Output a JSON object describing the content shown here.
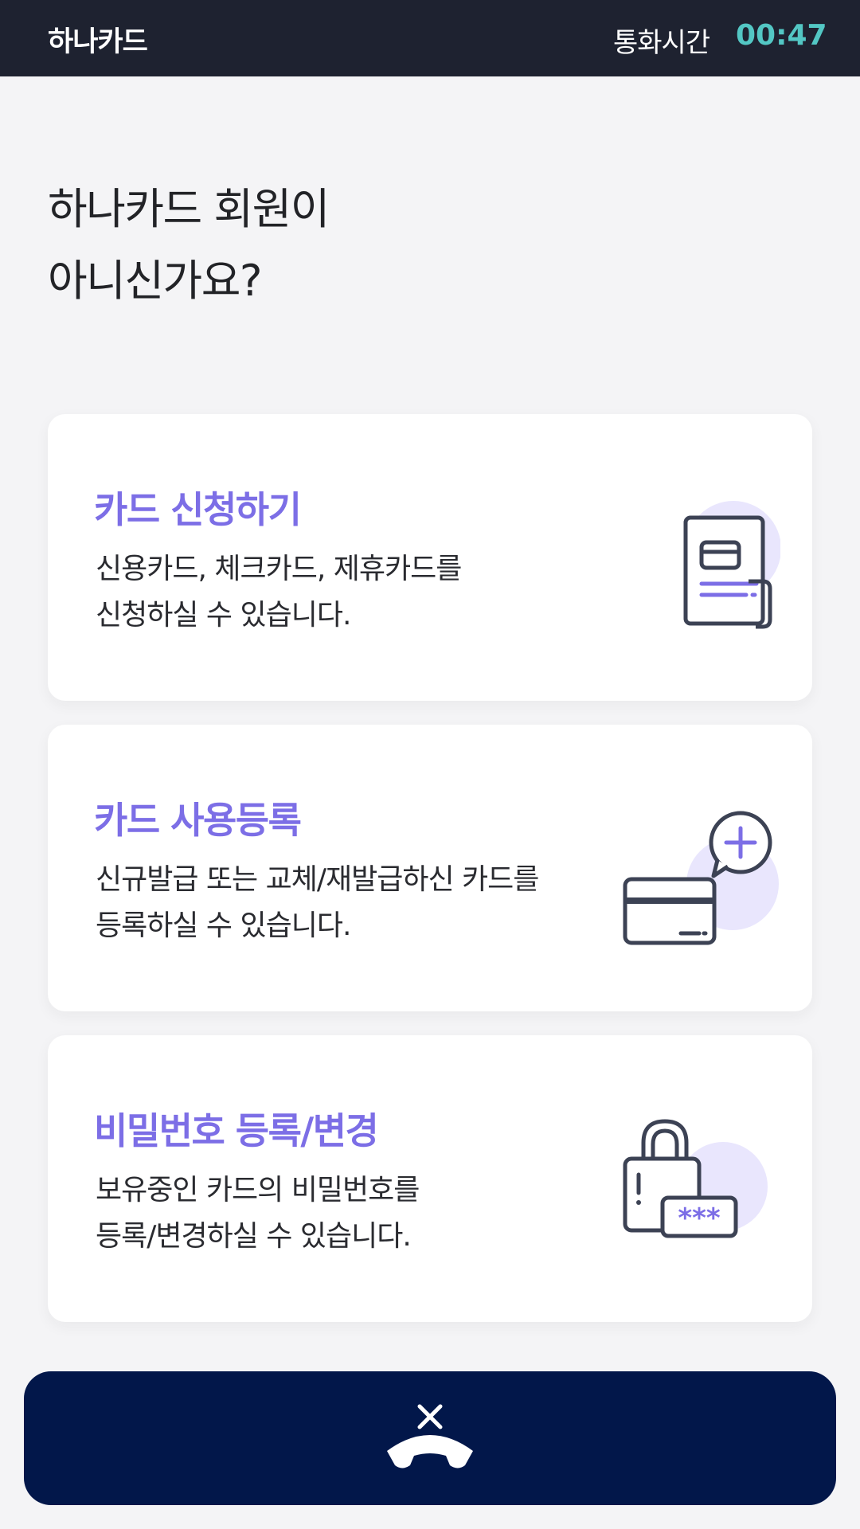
{
  "header": {
    "brand": "하나카드",
    "call_label": "통화시간",
    "call_time": "00:47"
  },
  "title": {
    "line1": "하나카드 회원이",
    "line2": "아니신가요?"
  },
  "cards": [
    {
      "title": "카드 신청하기",
      "desc_line1": "신용카드, 체크카드, 제휴카드를",
      "desc_line2": "신청하실 수 있습니다.",
      "icon": "document-card-icon"
    },
    {
      "title": "카드 사용등록",
      "desc_line1": "신규발급 또는 교체/재발급하신 카드를",
      "desc_line2": "등록하실 수 있습니다.",
      "icon": "card-add-icon"
    },
    {
      "title": "비밀번호 등록/변경",
      "desc_line1": "보유중인 카드의 비밀번호를",
      "desc_line2": "등록/변경하실 수 있습니다.",
      "icon": "lock-password-icon"
    }
  ],
  "footer": {
    "icon": "hang-up-icon"
  },
  "colors": {
    "topbar": "#1e2230",
    "accent_teal": "#53c7c4",
    "accent_purple": "#7c6ee6",
    "hangup_bg": "#02174a",
    "background": "#f4f4f6"
  }
}
